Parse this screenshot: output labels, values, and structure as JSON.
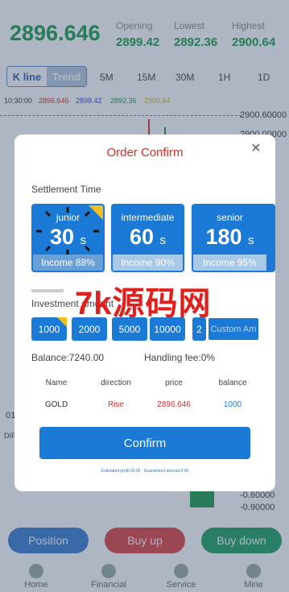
{
  "header": {
    "price": "2896.646",
    "opening_label": "Opening",
    "opening_value": "2899.42",
    "lowest_label": "Lowest",
    "lowest_value": "2892.36",
    "highest_label": "Highest",
    "highest_value": "2900.64"
  },
  "chart_toolbar": {
    "kline": "K line",
    "trend": "Trend",
    "timeframes": [
      "5M",
      "15M",
      "30M",
      "1H",
      "1D"
    ]
  },
  "ohlc_row": {
    "time": "10:30:00",
    "o": "2896.646",
    "h": "2899.42",
    "l": "2892.36",
    "c": "2900.64"
  },
  "axis": {
    "labels": [
      "2900.60000",
      "2900.00000",
      "-0.60000",
      "-0.90000"
    ],
    "left_partial": [
      "01",
      "DIF"
    ]
  },
  "bottom_buttons": {
    "position": "Position",
    "buy_up": "Buy up",
    "buy_down": "Buy down"
  },
  "nav": [
    "Home",
    "Financial",
    "Service",
    "Mine"
  ],
  "modal": {
    "title": "Order Confirm",
    "settlement_label": "Settlement Time",
    "plans": [
      {
        "name": "junior",
        "seconds": "30",
        "unit": "s",
        "income": "Income 88%"
      },
      {
        "name": "intermediate",
        "seconds": "60",
        "unit": "s",
        "income": "Income 90%"
      },
      {
        "name": "senior",
        "seconds": "180",
        "unit": "s",
        "income": "Income 95%"
      }
    ],
    "investment_label": "Investment amount",
    "amounts": [
      "1000",
      "2000",
      "5000",
      "10000",
      "2"
    ],
    "custom_placeholder": "Custom Am",
    "balance": "Balance:7240.00",
    "handling_fee": "Handling fee:0%",
    "table_headers": [
      "Name",
      "direction",
      "price",
      "balance"
    ],
    "table_row": {
      "name": "GOLD",
      "direction": "Rise",
      "price": "2896.646",
      "balance": "1000"
    },
    "confirm": "Confirm",
    "estimated": "Estimated profit:00.00",
    "guaranteed": "Guaranteed amount:0.00"
  },
  "watermark": "7k源码网",
  "colors": {
    "green": "#1a9a4a",
    "blue": "#1a7ad6",
    "red": "#d03028"
  }
}
